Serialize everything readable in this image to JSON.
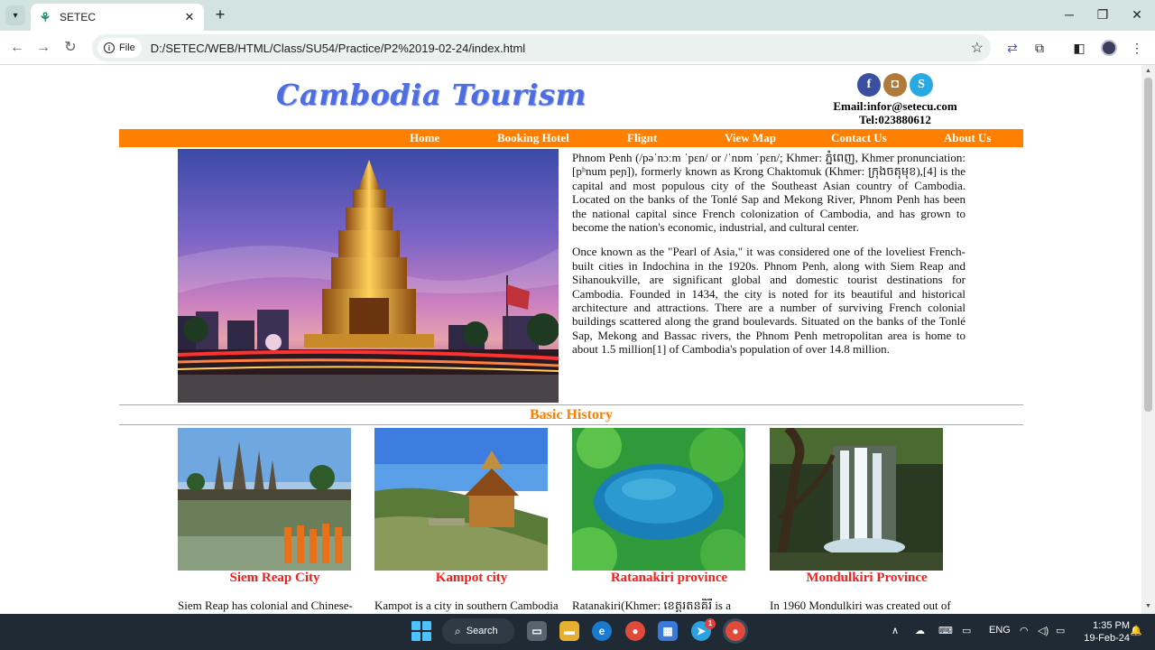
{
  "browser": {
    "tab_title": "SETEC",
    "site_chip": "File",
    "url": "D:/SETEC/WEB/HTML/Class/SU54/Practice/P2%2019-02-24/index.html"
  },
  "site": {
    "logo": "Cambodia Tourism",
    "email": "Email:infor@setecu.com",
    "tel": "Tel:023880612",
    "nav": [
      "Home",
      "Booking Hotel",
      "Flignt",
      "View Map",
      "Contact Us",
      "About Us"
    ],
    "intro": [
      "Phnom Penh (/pəˈnɔːm ˈpɛn/ or /ˈnɒm ˈpɛn/; Khmer: ភ្នំពេញ, Khmer pronunciation: [pʰnum peɲ]), formerly known as Krong Chaktomuk (Khmer: ក្រុងចតុមុខ),[4] is the capital and most populous city of the Southeast Asian country of Cambodia. Located on the banks of the Tonlé Sap and Mekong River, Phnom Penh has been the national capital since French colonization of Cambodia, and has grown to become the nation's economic, industrial, and cultural center.",
      "Once known as the \"Pearl of Asia,\" it was considered one of the loveliest French-built cities in Indochina in the 1920s. Phnom Penh, along with Siem Reap and Sihanoukville, are significant global and domestic tourist destinations for Cambodia. Founded in 1434, the city is noted for its beautiful and historical architecture and attractions. There are a number of surviving French colonial buildings scattered along the grand boulevards. Situated on the banks of the Tonlé Sap, Mekong and Bassac rivers, the Phnom Penh metropolitan area is home to about 1.5 million[1] of Cambodia's population of over 14.8 million."
    ],
    "section_title": "Basic History",
    "cards": [
      {
        "title": "Siem Reap City",
        "text": "Siem Reap has colonial and Chinese-"
      },
      {
        "title": "Kampot city",
        "text": "Kampot is a city in southern Cambodia"
      },
      {
        "title": "Ratanakiri province",
        "text": "Ratanakiri(Khmer: ខេត្តរតនគិរី is a"
      },
      {
        "title": "Mondulkiri Province",
        "text": "In 1960 Mondulkiri was created out of"
      }
    ]
  },
  "taskbar": {
    "search_label": "Search",
    "lang": "ENG",
    "time": "1:35 PM",
    "date": "19-Feb-24",
    "telegram_badge": "1"
  },
  "colors": {
    "accent_orange": "#ff8000",
    "card_title_red": "#ff1a1a",
    "logo_blue": "#4d6de0"
  }
}
